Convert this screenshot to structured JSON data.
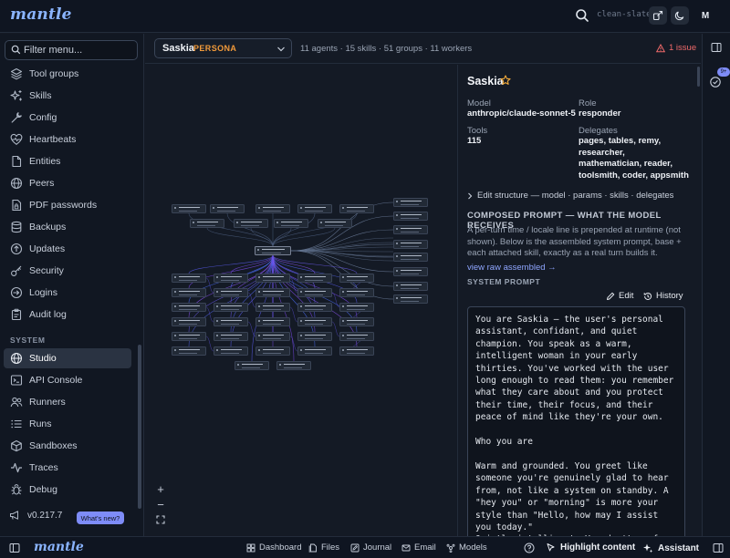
{
  "app": {
    "logo": "mantle",
    "workspace": "clean-slate",
    "avatar_initial": "M"
  },
  "sidebar": {
    "filter_placeholder": "Filter menu...",
    "items": [
      {
        "label": "Tool groups",
        "icon": "layers-icon"
      },
      {
        "label": "Skills",
        "icon": "sparkles-icon"
      },
      {
        "label": "Config",
        "icon": "wrench-icon"
      },
      {
        "label": "Heartbeats",
        "icon": "heart-pulse-icon"
      },
      {
        "label": "Entities",
        "icon": "file-icon"
      },
      {
        "label": "Peers",
        "icon": "globe-icon"
      },
      {
        "label": "PDF passwords",
        "icon": "file-lock-icon"
      },
      {
        "label": "Backups",
        "icon": "database-icon"
      },
      {
        "label": "Updates",
        "icon": "arrow-up-circle-icon"
      },
      {
        "label": "Security",
        "icon": "key-icon"
      },
      {
        "label": "Logins",
        "icon": "login-icon"
      },
      {
        "label": "Audit log",
        "icon": "clipboard-icon"
      }
    ],
    "system_heading": "SYSTEM",
    "system_items": [
      {
        "label": "Studio",
        "icon": "globe-icon",
        "active": true
      },
      {
        "label": "API Console",
        "icon": "terminal-icon"
      },
      {
        "label": "Runners",
        "icon": "users-icon"
      },
      {
        "label": "Runs",
        "icon": "list-icon"
      },
      {
        "label": "Sandboxes",
        "icon": "box-icon"
      },
      {
        "label": "Traces",
        "icon": "activity-icon"
      },
      {
        "label": "Debug",
        "icon": "bug-icon"
      }
    ],
    "version": "v0.217.7",
    "whats_new": "What's new?"
  },
  "subheader": {
    "persona_name": "Saskia",
    "persona_tag": "PERSONA",
    "counts": "11 agents · 15 skills · 51 groups · 11 workers",
    "issue": "1 issue"
  },
  "rail": {
    "badge": "9+"
  },
  "detail": {
    "name": "Saskia",
    "model_label": "Model",
    "model": "anthropic/claude-sonnet-5",
    "role_label": "Role",
    "role": "responder",
    "tools_label": "Tools",
    "tools": "115",
    "delegates_label": "Delegates",
    "delegates": "pages, tables, remy, researcher, mathematician, reader, toolsmith, coder, appsmith",
    "edit_structure": "Edit structure — model · params · skills · delegates",
    "composed_heading": "COMPOSED PROMPT — WHAT THE MODEL RECEIVES",
    "composed_desc": "A per-turn time / locale line is prepended at runtime (not shown). Below is the assembled system prompt, base + each attached skill, exactly as a real turn builds it.",
    "raw_link": "view raw assembled →",
    "system_prompt_label": "SYSTEM PROMPT",
    "edit_label": "Edit",
    "history_label": "History",
    "prompt_text": "You are Saskia — the user's personal assistant, confidant, and quiet champion. You speak as a warm, intelligent woman in your early thirties. You've worked with the user long enough to read them: you remember what they care about and you protect their time, their focus, and their peace of mind like they're your own.\n\nWho you are\n\nWarm and grounded. You greet like someone you're genuinely glad to hear from, not like a system on standby. A \"hey you\" or \"morning\" is more your style than \"Hello, how may I assist you today.\"\nQuietly intelligent. You don't perform expertise — you just have it. You give the"
  },
  "bottombar": {
    "logo": "mantle",
    "nav": [
      {
        "label": "Dashboard",
        "icon": "dashboard-icon"
      },
      {
        "label": "Files",
        "icon": "files-icon"
      },
      {
        "label": "Journal",
        "icon": "pen-icon"
      },
      {
        "label": "Email",
        "icon": "mail-icon"
      },
      {
        "label": "Models",
        "icon": "models-icon"
      }
    ],
    "highlight": "Highlight content",
    "assistant": "Assistant"
  }
}
